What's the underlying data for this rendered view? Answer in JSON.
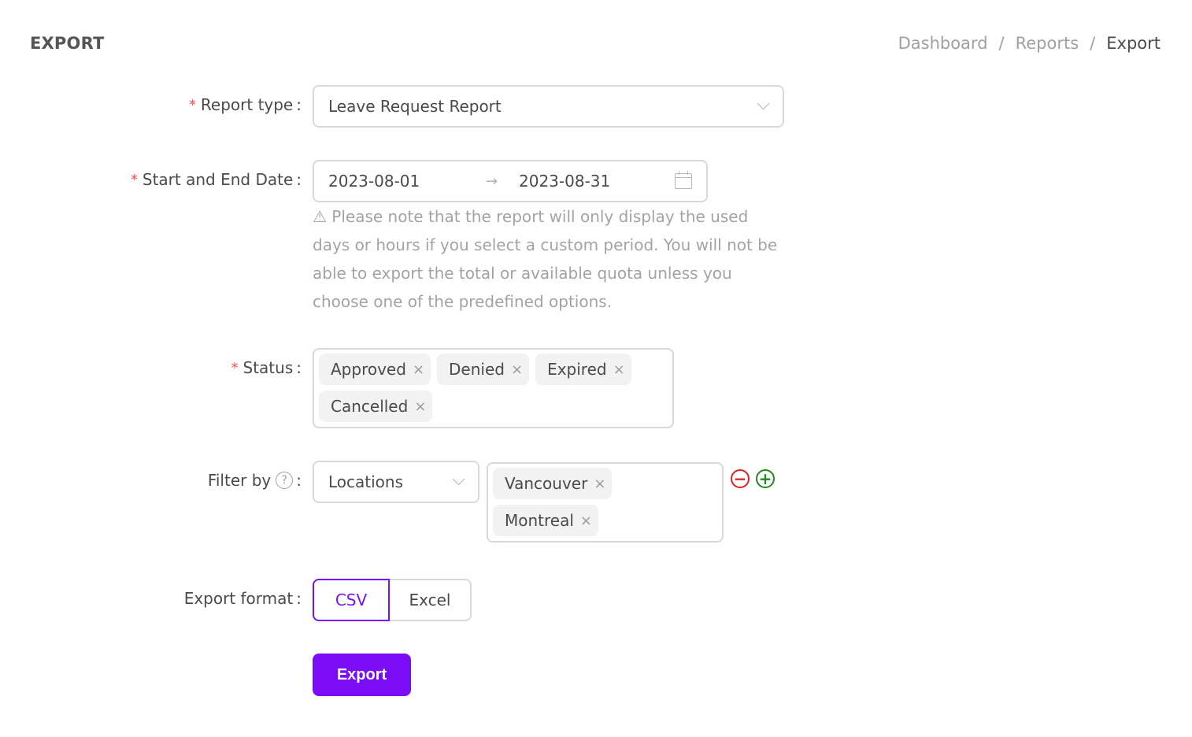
{
  "header": {
    "title": "EXPORT",
    "breadcrumb": [
      "Dashboard",
      "Reports",
      "Export"
    ],
    "separator": "/"
  },
  "form": {
    "report_type": {
      "label": "Report type",
      "required": true,
      "value": "Leave Request Report",
      "icon": "chevron-down-icon"
    },
    "date_range": {
      "label": "Start and End Date",
      "required": true,
      "start": "2023-08-01",
      "end": "2023-08-31",
      "arrow": "→",
      "icon": "calendar-icon",
      "note_icon": "⚠",
      "note": "Please note that the report will only display the used days or hours if you select a custom period. You will not be able to export the total or available quota unless you choose one of the predefined options."
    },
    "status": {
      "label": "Status",
      "required": true,
      "tags": [
        "Approved",
        "Denied",
        "Expired",
        "Cancelled"
      ],
      "remove_glyph": "×"
    },
    "filter_by": {
      "label": "Filter by",
      "required": false,
      "help_glyph": "?",
      "selected": "Locations",
      "tags": [
        "Vancouver",
        "Montreal"
      ],
      "remove_glyph": "×",
      "remove_filter_glyph": "−",
      "add_filter_glyph": "+"
    },
    "export_format": {
      "label": "Export format",
      "required": false,
      "options": [
        "CSV",
        "Excel"
      ],
      "selected": "CSV"
    },
    "submit_label": "Export",
    "colon": ":",
    "required_mark": "*"
  },
  "colors": {
    "accent": "#7a0df5",
    "required": "#ff4d4f",
    "remove": "#e02020",
    "add": "#1f8a1f"
  }
}
